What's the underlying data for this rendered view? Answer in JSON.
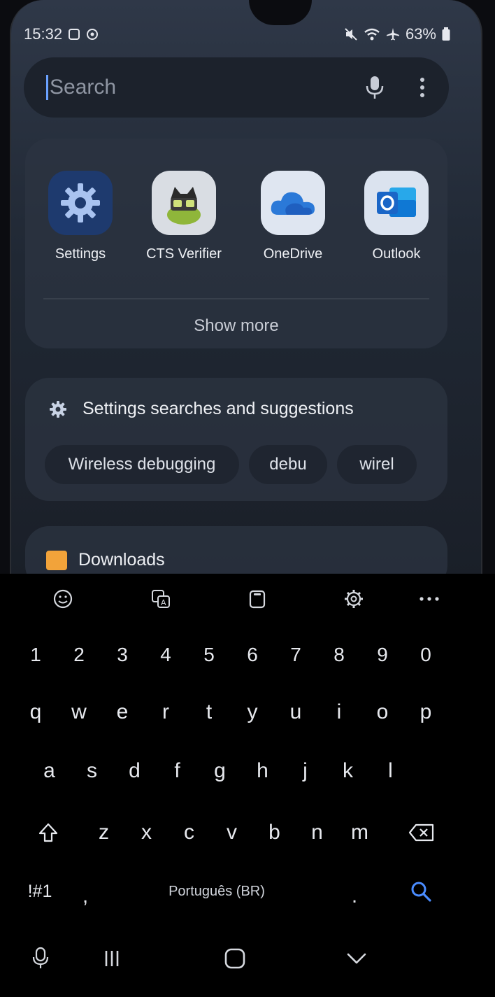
{
  "status_bar": {
    "time": "15:32",
    "battery": "63%"
  },
  "search": {
    "placeholder": "Search"
  },
  "apps": [
    {
      "label": "Settings",
      "icon": "settings-gear-icon"
    },
    {
      "label": "CTS Verifier",
      "icon": "cts-verifier-icon"
    },
    {
      "label": "OneDrive",
      "icon": "onedrive-cloud-icon"
    },
    {
      "label": "Outlook",
      "icon": "outlook-icon"
    }
  ],
  "apps_show_more": "Show more",
  "suggestions": {
    "title": "Settings searches and suggestions",
    "chips": [
      "Wireless debugging",
      "debu",
      "wirel"
    ]
  },
  "downloads": {
    "title": "Downloads"
  },
  "keyboard": {
    "number_row": [
      "1",
      "2",
      "3",
      "4",
      "5",
      "6",
      "7",
      "8",
      "9",
      "0"
    ],
    "row1": [
      "q",
      "w",
      "e",
      "r",
      "t",
      "y",
      "u",
      "i",
      "o",
      "p"
    ],
    "row2": [
      "a",
      "s",
      "d",
      "f",
      "g",
      "h",
      "j",
      "k",
      "l"
    ],
    "row3": [
      "z",
      "x",
      "c",
      "v",
      "b",
      "n",
      "m"
    ],
    "symbols_label": "!#1",
    "comma": ",",
    "space_label": "Português (BR)",
    "period": "."
  },
  "colors": {
    "accent": "#4a8cff",
    "onedrive": "#2b79d8",
    "outlook": "#1a66c7",
    "downloads_folder": "#f2a33a"
  }
}
